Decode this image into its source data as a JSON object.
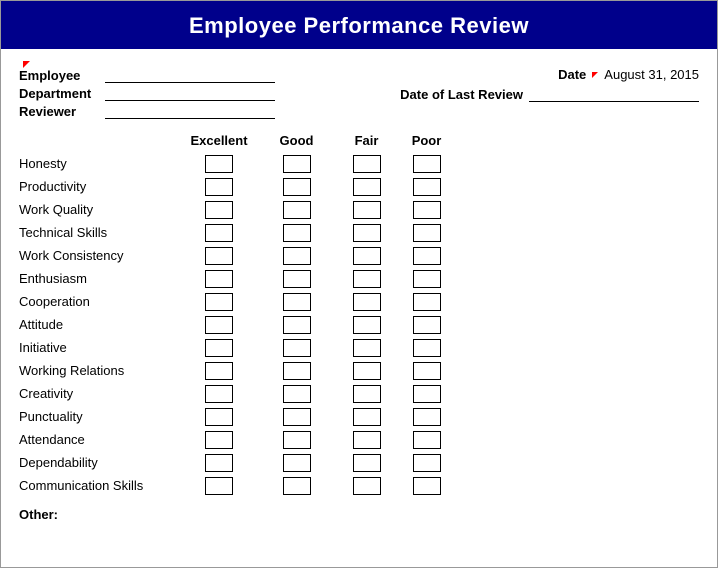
{
  "title": "Employee Performance Review",
  "header": {
    "employee_label": "Employee",
    "department_label": "Department",
    "reviewer_label": "Reviewer",
    "date_label": "Date",
    "date_value": "August 31, 2015",
    "last_review_label": "Date of Last Review"
  },
  "rating_headers": {
    "excellent": "Excellent",
    "good": "Good",
    "fair": "Fair",
    "poor": "Poor"
  },
  "criteria": [
    "Honesty",
    "Productivity",
    "Work Quality",
    "Technical Skills",
    "Work Consistency",
    "Enthusiasm",
    "Cooperation",
    "Attitude",
    "Initiative",
    "Working Relations",
    "Creativity",
    "Punctuality",
    "Attendance",
    "Dependability",
    "Communication Skills"
  ],
  "other_label": "Other:"
}
